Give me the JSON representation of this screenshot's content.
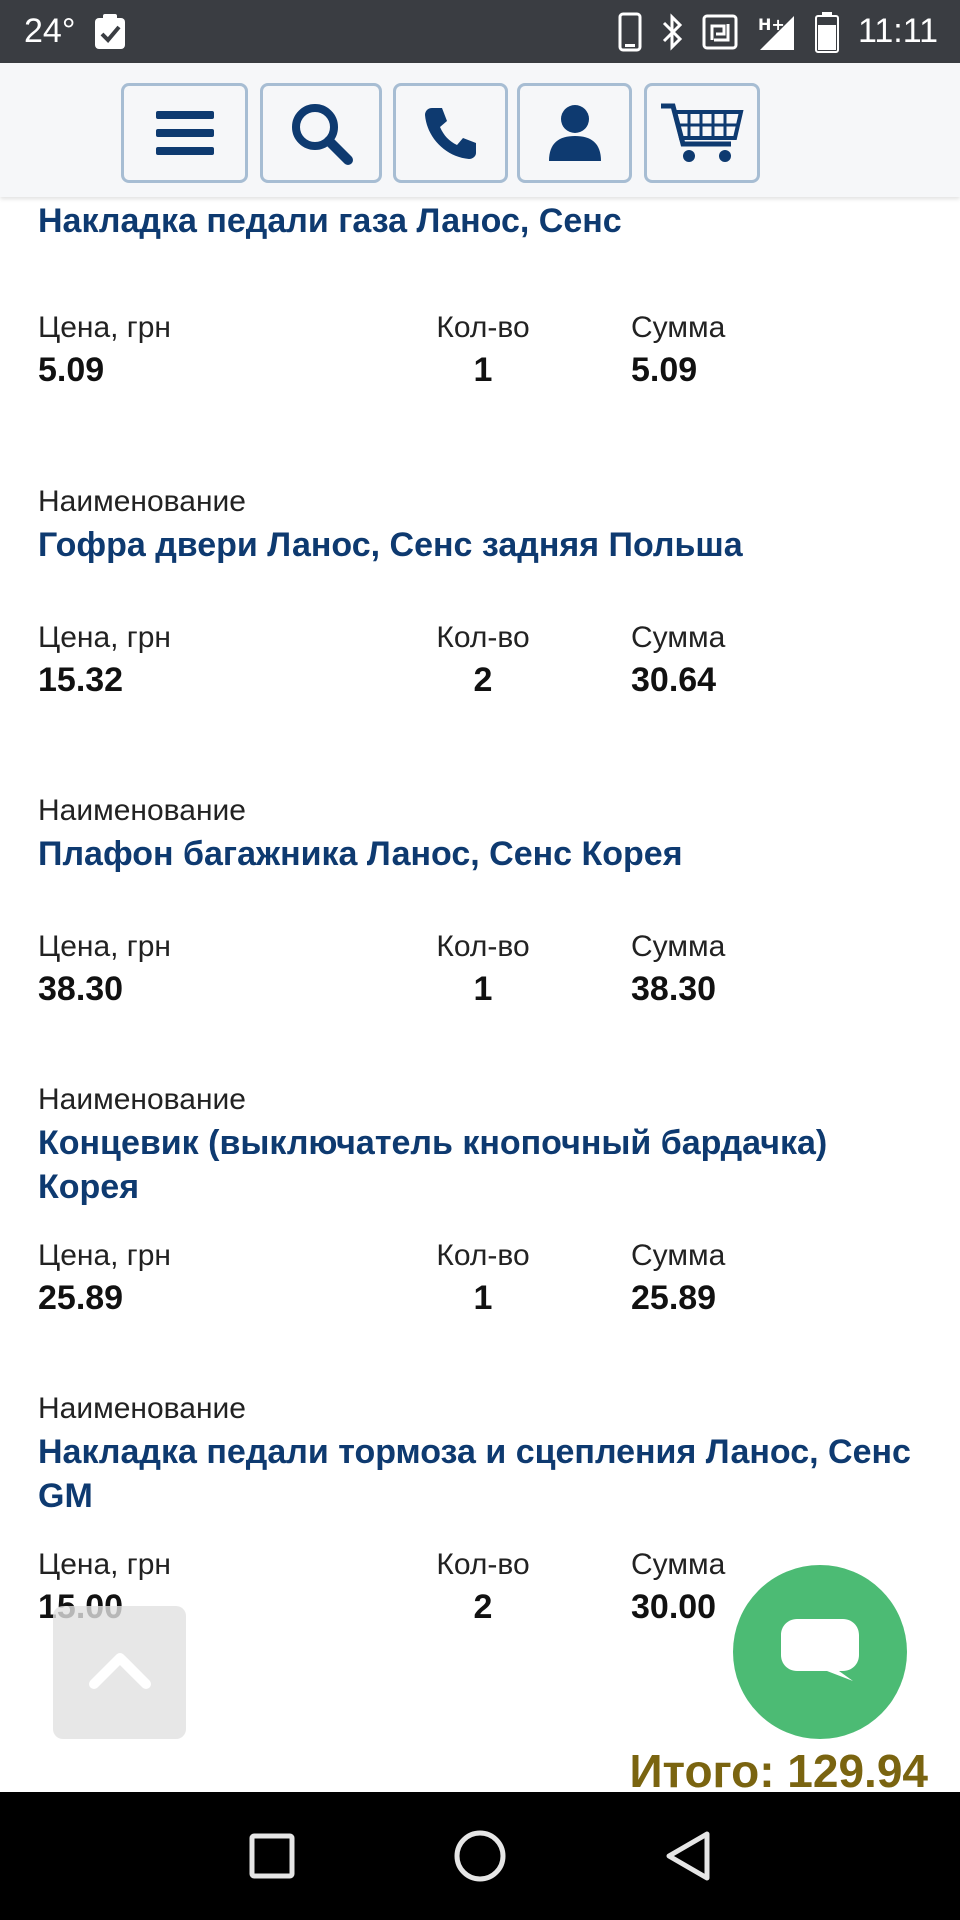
{
  "status_bar": {
    "temperature": "24°",
    "time": "11:11",
    "icons": [
      "task-check-icon",
      "phone-icon",
      "bluetooth-icon",
      "nfc-icon",
      "signal-h-plus-icon",
      "battery-icon"
    ]
  },
  "top_nav": {
    "buttons": [
      "menu-icon",
      "search-icon",
      "phone-icon",
      "user-icon",
      "cart-icon"
    ],
    "accent": "#0e3a70"
  },
  "labels": {
    "name": "Наименование",
    "price": "Цена, грн",
    "qty": "Кол-во",
    "sum": "Сумма"
  },
  "items": [
    {
      "name": "Накладка педали газа Ланос, Сенс",
      "price": "5.09",
      "qty": "1",
      "sum": "5.09"
    },
    {
      "name": "Гофра двери Ланос, Сенс задняя Польша",
      "price": "15.32",
      "qty": "2",
      "sum": "30.64"
    },
    {
      "name": "Плафон багажника Ланос, Сенс Корея",
      "price": "38.30",
      "qty": "1",
      "sum": "38.30"
    },
    {
      "name": "Концевик (выключатель кнопочный бардачка) Корея",
      "price": "25.89",
      "qty": "1",
      "sum": "25.89"
    },
    {
      "name": "Накладка педали тормоза и сцепления Ланос, Сенс GM",
      "price": "15.00",
      "qty": "2",
      "sum": "30.00"
    }
  ],
  "total": "Итого: 129.94",
  "colors": {
    "item_name": "#0e3a70",
    "total": "#7a6410",
    "chat": "#4cbb74",
    "status_bar": "#3a3d42"
  }
}
